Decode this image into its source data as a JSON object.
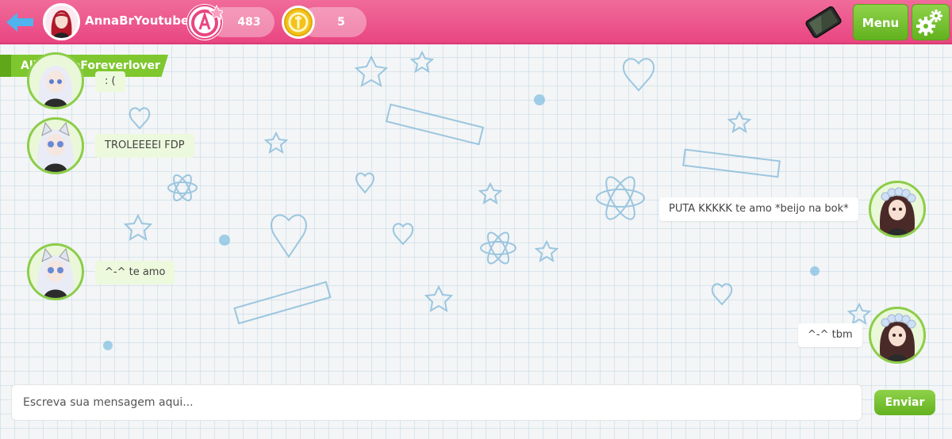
{
  "header": {
    "username": "AnnaBrYoutube",
    "points": "483",
    "coins": "5",
    "menu_label": "Menu"
  },
  "chat": {
    "partner_name": "AliceLoveForeverlover",
    "messages": [
      {
        "side": "left",
        "text": ": ("
      },
      {
        "side": "left",
        "text": "TROLEEEEI FDP"
      },
      {
        "side": "right",
        "text": "PUTA KKKKK te amo *beijo na bok*"
      },
      {
        "side": "left",
        "text": "^-^ te amo"
      },
      {
        "side": "right",
        "text": "^-^ tbm"
      }
    ]
  },
  "composer": {
    "placeholder": "Escreva sua mensagem aqui...",
    "send_label": "Enviar"
  },
  "colors": {
    "header_pink": "#e94681",
    "accent_green": "#7fc72f",
    "bubble_green": "#ecf9dd",
    "coin_gold": "#f3c21a"
  },
  "icons": [
    "back-arrow-icon",
    "points-badge-icon",
    "coin-icon",
    "phone-icon",
    "gears-icon"
  ]
}
